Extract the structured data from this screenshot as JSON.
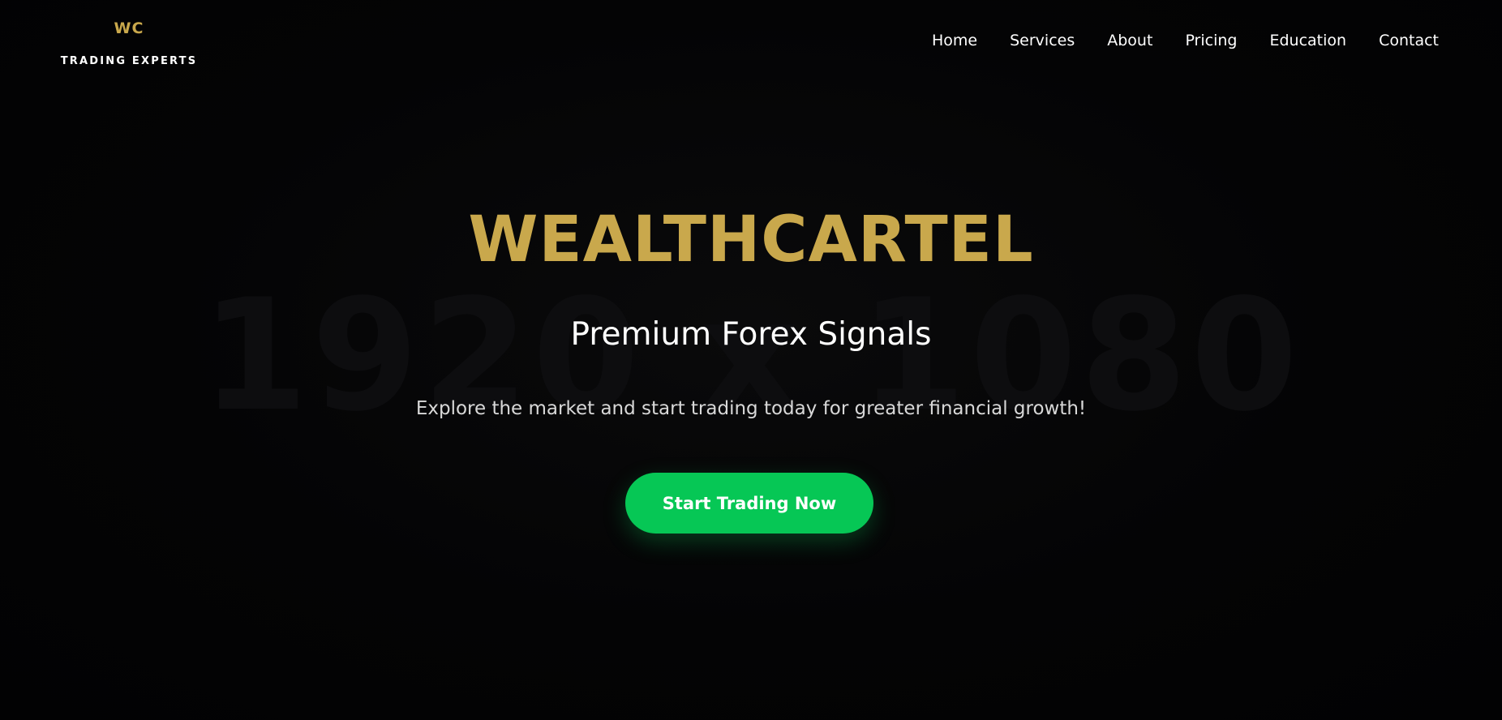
{
  "header": {
    "logo_mark": "WC",
    "logo_tagline": "TRADING EXPERTS",
    "nav": [
      {
        "label": "Home"
      },
      {
        "label": "Services"
      },
      {
        "label": "About"
      },
      {
        "label": "Pricing"
      },
      {
        "label": "Education"
      },
      {
        "label": "Contact"
      }
    ]
  },
  "hero": {
    "watermark": "1920 x 1080",
    "title": "WEALTHCARTEL",
    "subtitle": "Premium Forex Signals",
    "description": "Explore the market and start trading today for greater financial growth!",
    "cta_label": "Start Trading Now"
  },
  "colors": {
    "background": "#030304",
    "brand_gold": "#c9a84c",
    "cta_green": "#06c755",
    "text": "#ffffff"
  }
}
